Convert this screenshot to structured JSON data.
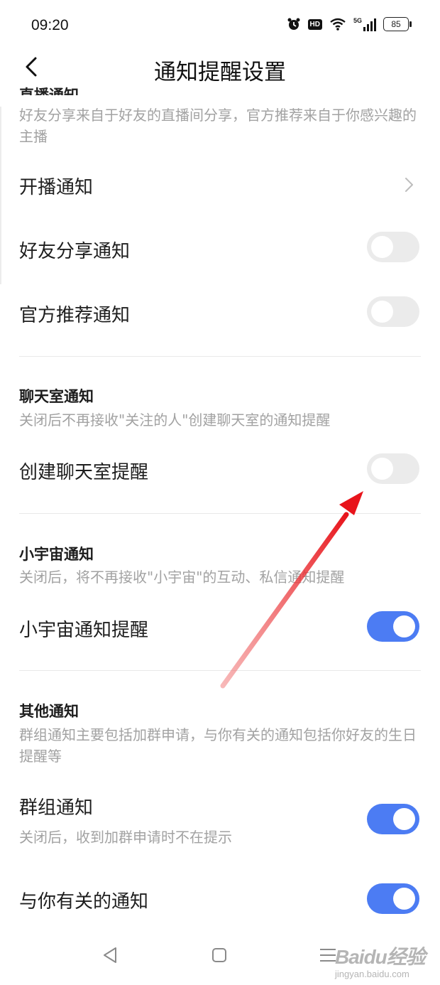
{
  "status_bar": {
    "time": "09:20",
    "hd_label": "HD",
    "signal_label": "5G",
    "battery": "85",
    "icons": [
      "alarm-icon",
      "hd-icon",
      "wifi-icon",
      "signal-5g-icon",
      "battery-icon"
    ]
  },
  "header": {
    "title": "通知提醒设置",
    "back_icon": "chevron-left-icon"
  },
  "live_section": {
    "cut_title": "直播通知",
    "desc": "好友分享来自于好友的直播间分享，官方推荐来自于你感兴趣的主播",
    "items": [
      {
        "label": "开播通知",
        "control": "chevron-right-icon"
      },
      {
        "label": "好友分享通知",
        "enabled": false
      },
      {
        "label": "官方推荐通知",
        "enabled": false
      }
    ]
  },
  "chatroom_section": {
    "title": "聊天室通知",
    "desc": "关闭后不再接收\"关注的人\"创建聊天室的通知提醒",
    "items": [
      {
        "label": "创建聊天室提醒",
        "enabled": false
      }
    ]
  },
  "universe_section": {
    "title": "小宇宙通知",
    "desc": "关闭后，将不再接收\"小宇宙\"的互动、私信通知提醒",
    "items": [
      {
        "label": "小宇宙通知提醒",
        "enabled": true
      }
    ]
  },
  "other_section": {
    "title": "其他通知",
    "desc": "群组通知主要包括加群申请，与你有关的通知包括你好友的生日提醒等",
    "items": [
      {
        "label": "群组通知",
        "sublabel": "关闭后，收到加群申请时不在提示",
        "enabled": true
      },
      {
        "label": "与你有关的通知",
        "enabled": true
      }
    ]
  },
  "nav_bar": {
    "icons": [
      "back-triangle-icon",
      "home-square-icon",
      "menu-lines-icon"
    ]
  },
  "watermark": {
    "main": "Baidu经验",
    "sub": "jingyan.baidu.com"
  },
  "colors": {
    "toggle_on": "#4c7cf3",
    "toggle_off": "#ebebeb",
    "annotation_arrow": "#e8141b"
  }
}
